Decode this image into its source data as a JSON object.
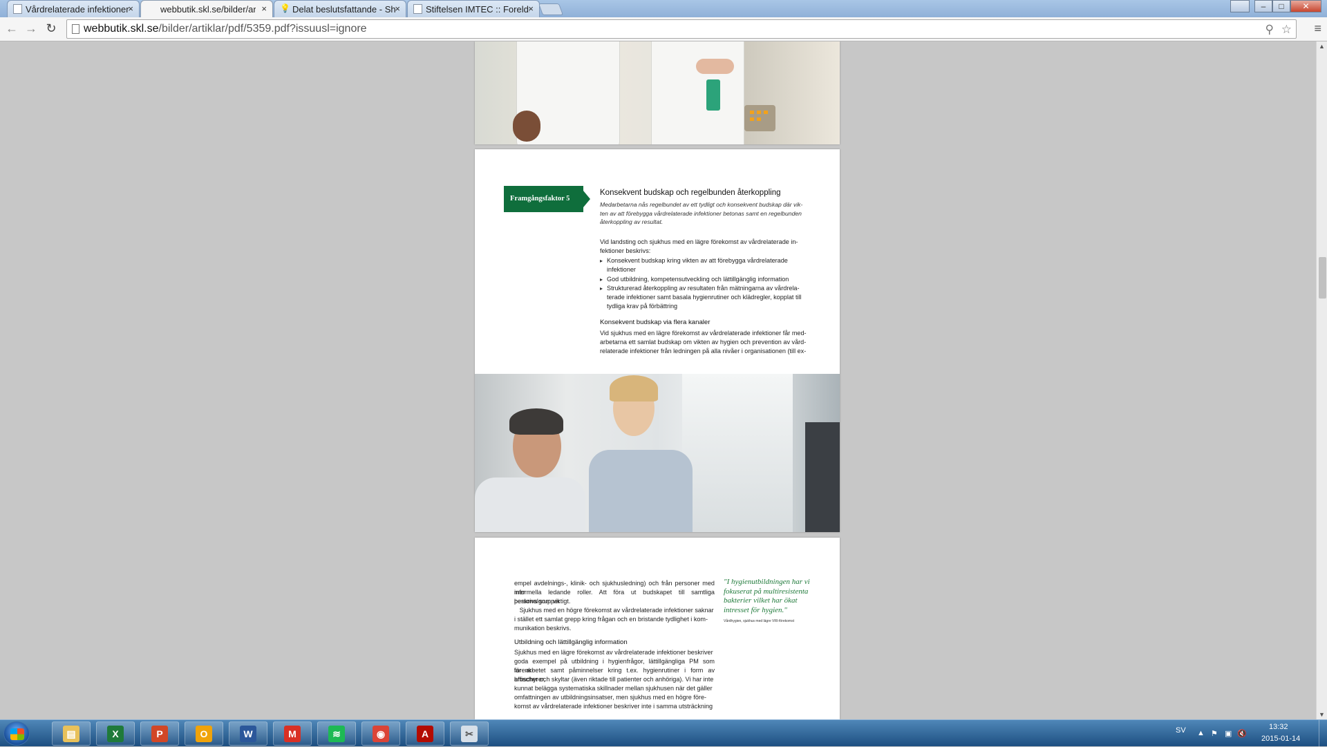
{
  "browser": {
    "tabs": [
      {
        "title": "Vårdrelaterade infektioner",
        "active": false,
        "icon": "page-icon"
      },
      {
        "title": "webbutik.skl.se/bilder/arti",
        "active": true,
        "icon": "none"
      },
      {
        "title": "Delat beslutsfattande - Sh",
        "active": false,
        "icon": "bulb-icon"
      },
      {
        "title": "Stiftelsen IMTEC :: Foreldr",
        "active": false,
        "icon": "page-icon"
      }
    ],
    "close_glyph": "×",
    "url_host": "webbutik.skl.se",
    "url_path": "/bilder/artiklar/pdf/5359.pdf?issuusl=ignore",
    "back_glyph": "←",
    "forward_glyph": "→",
    "reload_glyph": "↻",
    "search_glyph": "⚲",
    "star_glyph": "☆",
    "menu_glyph": "≡",
    "window_controls": {
      "min": "–",
      "max": "□",
      "close": "✕"
    }
  },
  "document": {
    "badge": "Framgångsfaktor 5",
    "heading": "Konsekvent budskap och regelbunden återkoppling",
    "intro_lines": [
      "Medarbetarna nås regelbundet av ett tydligt och konsekvent budskap där vik-",
      "ten av att förebygga vårdrelaterade infektioner betonas samt en regelbunden",
      "återkoppling av resultat."
    ],
    "para1_lines": [
      "Vid landsting och sjukhus med en lägre förekomst av vårdrelaterade in-",
      "fektioner beskrivs:"
    ],
    "bullets": [
      [
        "Konsekvent budskap kring vikten av att förebygga vårdrelaterade",
        "infektioner"
      ],
      [
        "God utbildning, kompetensutveckling och lättillgänglig information"
      ],
      [
        "Strukturerad återkoppling av resultaten från mätningarna av vårdrela-",
        "terade infektioner samt basala hygienrutiner och klädregler, kopplat till",
        "tydliga krav på förbättring"
      ]
    ],
    "subheading1": "Konsekvent budskap via flera kanaler",
    "para2_lines": [
      "Vid sjukhus med en lägre förekomst av vårdrelaterade infektioner får med-",
      "arbetarna ett samlat budskap om vikten av hygien och prevention av vård-",
      "relaterade infektioner från ledningen på alla nivåer i organisationen (till ex-"
    ],
    "page3_lines": [
      "empel avdelnings-, klinik- och sjukhusledning) och från personer med mer",
      "informella ledande roller. Att föra ut budskapet till samtliga personalgrupper",
      "beskrivs som viktigt.",
      "   Sjukhus med en högre förekomst av vårdrelaterade infektioner saknar",
      "i stället ett samlat grepp kring frågan och en bristande tydlighet i kom-",
      "munikation beskrivs."
    ],
    "subheading2": "Utbildning och lättillgänglig information",
    "page3_lines2": [
      "Sjukhus med en lägre förekomst av vårdrelaterade infektioner beskriver",
      "goda exempel på utbildning i hygienfrågor, lättillgängliga PM som förenk-",
      "lar arbetet samt påminnelser kring t.ex. hygienrutiner i form av broschyrer,",
      "affischer och skyltar (även riktade till patienter och anhöriga). Vi har inte",
      "kunnat belägga systematiska skillnader mellan sjukhusen när det gäller",
      "omfattningen av utbildningsinsatser, men sjukhus med en högre före-",
      "komst av vårdrelaterade infektioner beskriver inte i samma utsträckning"
    ],
    "quote_lines": [
      "\"I hygienutbildningen har vi",
      "fokuserat på multiresistenta",
      "bakterier vilket har ökat",
      "intresset för hygien.\""
    ],
    "quote_source": "Vårdhygien, sjukhus med lägre VRI-förekomst"
  },
  "taskbar": {
    "apps": [
      {
        "name": "file-explorer",
        "glyph": "▤",
        "color": "#e8c15a"
      },
      {
        "name": "excel",
        "glyph": "X",
        "color": "#1f7a3a"
      },
      {
        "name": "powerpoint",
        "glyph": "P",
        "color": "#d24726"
      },
      {
        "name": "outlook",
        "glyph": "O",
        "color": "#f0a30a"
      },
      {
        "name": "word",
        "glyph": "W",
        "color": "#2b579a"
      },
      {
        "name": "gmail",
        "glyph": "M",
        "color": "#d93025"
      },
      {
        "name": "spotify",
        "glyph": "≋",
        "color": "#1db954"
      },
      {
        "name": "chrome",
        "glyph": "◉",
        "color": "#db4437"
      },
      {
        "name": "acrobat",
        "glyph": "A",
        "color": "#b30b00"
      },
      {
        "name": "snipping-tool",
        "glyph": "✂",
        "color": "#d7dfe8"
      }
    ],
    "language": "SV",
    "time": "13:32",
    "date": "2015-01-14"
  }
}
